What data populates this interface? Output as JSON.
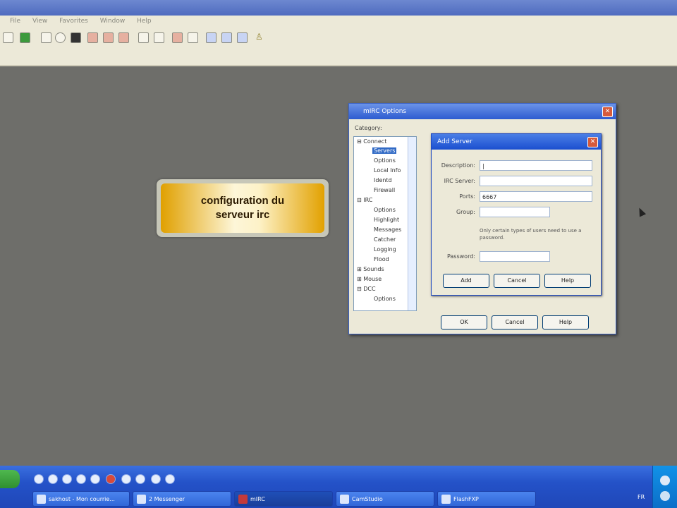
{
  "menu": {
    "items": [
      "File",
      "View",
      "Favorites",
      "Window",
      "Help"
    ]
  },
  "banner": {
    "line1": "configuration du",
    "line2": "serveur irc"
  },
  "options_dialog": {
    "title": "mIRC Options",
    "category_label": "Category:",
    "tree": [
      {
        "label": "⊟ Connect",
        "level": 0
      },
      {
        "label": "Servers",
        "level": 1,
        "selected": true
      },
      {
        "label": "Options",
        "level": 1
      },
      {
        "label": "Local Info",
        "level": 1
      },
      {
        "label": "Identd",
        "level": 1
      },
      {
        "label": "Firewall",
        "level": 1
      },
      {
        "label": "⊟ IRC",
        "level": 0
      },
      {
        "label": "Options",
        "level": 1
      },
      {
        "label": "Highlight",
        "level": 1
      },
      {
        "label": "Messages",
        "level": 1
      },
      {
        "label": "Catcher",
        "level": 1
      },
      {
        "label": "Logging",
        "level": 1
      },
      {
        "label": "Flood",
        "level": 1
      },
      {
        "label": "⊞ Sounds",
        "level": 0
      },
      {
        "label": "⊞ Mouse",
        "level": 0
      },
      {
        "label": "⊟ DCC",
        "level": 0
      },
      {
        "label": "Options",
        "level": 1
      }
    ],
    "ok_label": "OK",
    "cancel_label": "Cancel",
    "help_label": "Help"
  },
  "add_server": {
    "title": "Add Server",
    "description_label": "Description:",
    "description_value": "|",
    "server_label": "IRC Server:",
    "server_value": "",
    "ports_label": "Ports:",
    "ports_value": "6667",
    "group_label": "Group:",
    "group_value": "",
    "note": "Only certain types of users need to use a password.",
    "password_label": "Password:",
    "password_value": "",
    "add_label": "Add",
    "cancel_label": "Cancel",
    "help_label": "Help"
  },
  "taskbar": {
    "tasks": [
      {
        "label": "sakhost - Mon courrie...",
        "active": false
      },
      {
        "label": "2 Messenger",
        "active": false
      },
      {
        "label": "mIRC",
        "active": true
      },
      {
        "label": "CamStudio",
        "active": false
      },
      {
        "label": "FlashFXP",
        "active": false
      }
    ],
    "tray_text": "FR"
  }
}
